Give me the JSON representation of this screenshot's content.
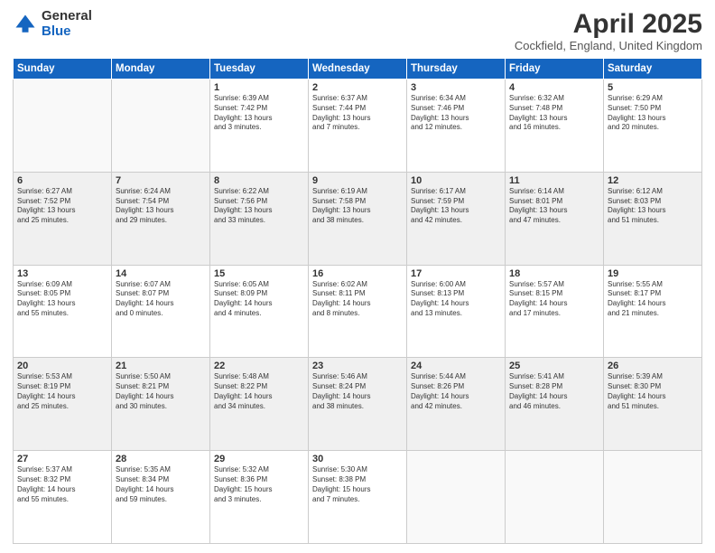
{
  "header": {
    "logo_general": "General",
    "logo_blue": "Blue",
    "month_title": "April 2025",
    "location": "Cockfield, England, United Kingdom"
  },
  "days_of_week": [
    "Sunday",
    "Monday",
    "Tuesday",
    "Wednesday",
    "Thursday",
    "Friday",
    "Saturday"
  ],
  "weeks": [
    [
      {
        "day": "",
        "info": ""
      },
      {
        "day": "",
        "info": ""
      },
      {
        "day": "1",
        "info": "Sunrise: 6:39 AM\nSunset: 7:42 PM\nDaylight: 13 hours\nand 3 minutes."
      },
      {
        "day": "2",
        "info": "Sunrise: 6:37 AM\nSunset: 7:44 PM\nDaylight: 13 hours\nand 7 minutes."
      },
      {
        "day": "3",
        "info": "Sunrise: 6:34 AM\nSunset: 7:46 PM\nDaylight: 13 hours\nand 12 minutes."
      },
      {
        "day": "4",
        "info": "Sunrise: 6:32 AM\nSunset: 7:48 PM\nDaylight: 13 hours\nand 16 minutes."
      },
      {
        "day": "5",
        "info": "Sunrise: 6:29 AM\nSunset: 7:50 PM\nDaylight: 13 hours\nand 20 minutes."
      }
    ],
    [
      {
        "day": "6",
        "info": "Sunrise: 6:27 AM\nSunset: 7:52 PM\nDaylight: 13 hours\nand 25 minutes."
      },
      {
        "day": "7",
        "info": "Sunrise: 6:24 AM\nSunset: 7:54 PM\nDaylight: 13 hours\nand 29 minutes."
      },
      {
        "day": "8",
        "info": "Sunrise: 6:22 AM\nSunset: 7:56 PM\nDaylight: 13 hours\nand 33 minutes."
      },
      {
        "day": "9",
        "info": "Sunrise: 6:19 AM\nSunset: 7:58 PM\nDaylight: 13 hours\nand 38 minutes."
      },
      {
        "day": "10",
        "info": "Sunrise: 6:17 AM\nSunset: 7:59 PM\nDaylight: 13 hours\nand 42 minutes."
      },
      {
        "day": "11",
        "info": "Sunrise: 6:14 AM\nSunset: 8:01 PM\nDaylight: 13 hours\nand 47 minutes."
      },
      {
        "day": "12",
        "info": "Sunrise: 6:12 AM\nSunset: 8:03 PM\nDaylight: 13 hours\nand 51 minutes."
      }
    ],
    [
      {
        "day": "13",
        "info": "Sunrise: 6:09 AM\nSunset: 8:05 PM\nDaylight: 13 hours\nand 55 minutes."
      },
      {
        "day": "14",
        "info": "Sunrise: 6:07 AM\nSunset: 8:07 PM\nDaylight: 14 hours\nand 0 minutes."
      },
      {
        "day": "15",
        "info": "Sunrise: 6:05 AM\nSunset: 8:09 PM\nDaylight: 14 hours\nand 4 minutes."
      },
      {
        "day": "16",
        "info": "Sunrise: 6:02 AM\nSunset: 8:11 PM\nDaylight: 14 hours\nand 8 minutes."
      },
      {
        "day": "17",
        "info": "Sunrise: 6:00 AM\nSunset: 8:13 PM\nDaylight: 14 hours\nand 13 minutes."
      },
      {
        "day": "18",
        "info": "Sunrise: 5:57 AM\nSunset: 8:15 PM\nDaylight: 14 hours\nand 17 minutes."
      },
      {
        "day": "19",
        "info": "Sunrise: 5:55 AM\nSunset: 8:17 PM\nDaylight: 14 hours\nand 21 minutes."
      }
    ],
    [
      {
        "day": "20",
        "info": "Sunrise: 5:53 AM\nSunset: 8:19 PM\nDaylight: 14 hours\nand 25 minutes."
      },
      {
        "day": "21",
        "info": "Sunrise: 5:50 AM\nSunset: 8:21 PM\nDaylight: 14 hours\nand 30 minutes."
      },
      {
        "day": "22",
        "info": "Sunrise: 5:48 AM\nSunset: 8:22 PM\nDaylight: 14 hours\nand 34 minutes."
      },
      {
        "day": "23",
        "info": "Sunrise: 5:46 AM\nSunset: 8:24 PM\nDaylight: 14 hours\nand 38 minutes."
      },
      {
        "day": "24",
        "info": "Sunrise: 5:44 AM\nSunset: 8:26 PM\nDaylight: 14 hours\nand 42 minutes."
      },
      {
        "day": "25",
        "info": "Sunrise: 5:41 AM\nSunset: 8:28 PM\nDaylight: 14 hours\nand 46 minutes."
      },
      {
        "day": "26",
        "info": "Sunrise: 5:39 AM\nSunset: 8:30 PM\nDaylight: 14 hours\nand 51 minutes."
      }
    ],
    [
      {
        "day": "27",
        "info": "Sunrise: 5:37 AM\nSunset: 8:32 PM\nDaylight: 14 hours\nand 55 minutes."
      },
      {
        "day": "28",
        "info": "Sunrise: 5:35 AM\nSunset: 8:34 PM\nDaylight: 14 hours\nand 59 minutes."
      },
      {
        "day": "29",
        "info": "Sunrise: 5:32 AM\nSunset: 8:36 PM\nDaylight: 15 hours\nand 3 minutes."
      },
      {
        "day": "30",
        "info": "Sunrise: 5:30 AM\nSunset: 8:38 PM\nDaylight: 15 hours\nand 7 minutes."
      },
      {
        "day": "",
        "info": ""
      },
      {
        "day": "",
        "info": ""
      },
      {
        "day": "",
        "info": ""
      }
    ]
  ]
}
